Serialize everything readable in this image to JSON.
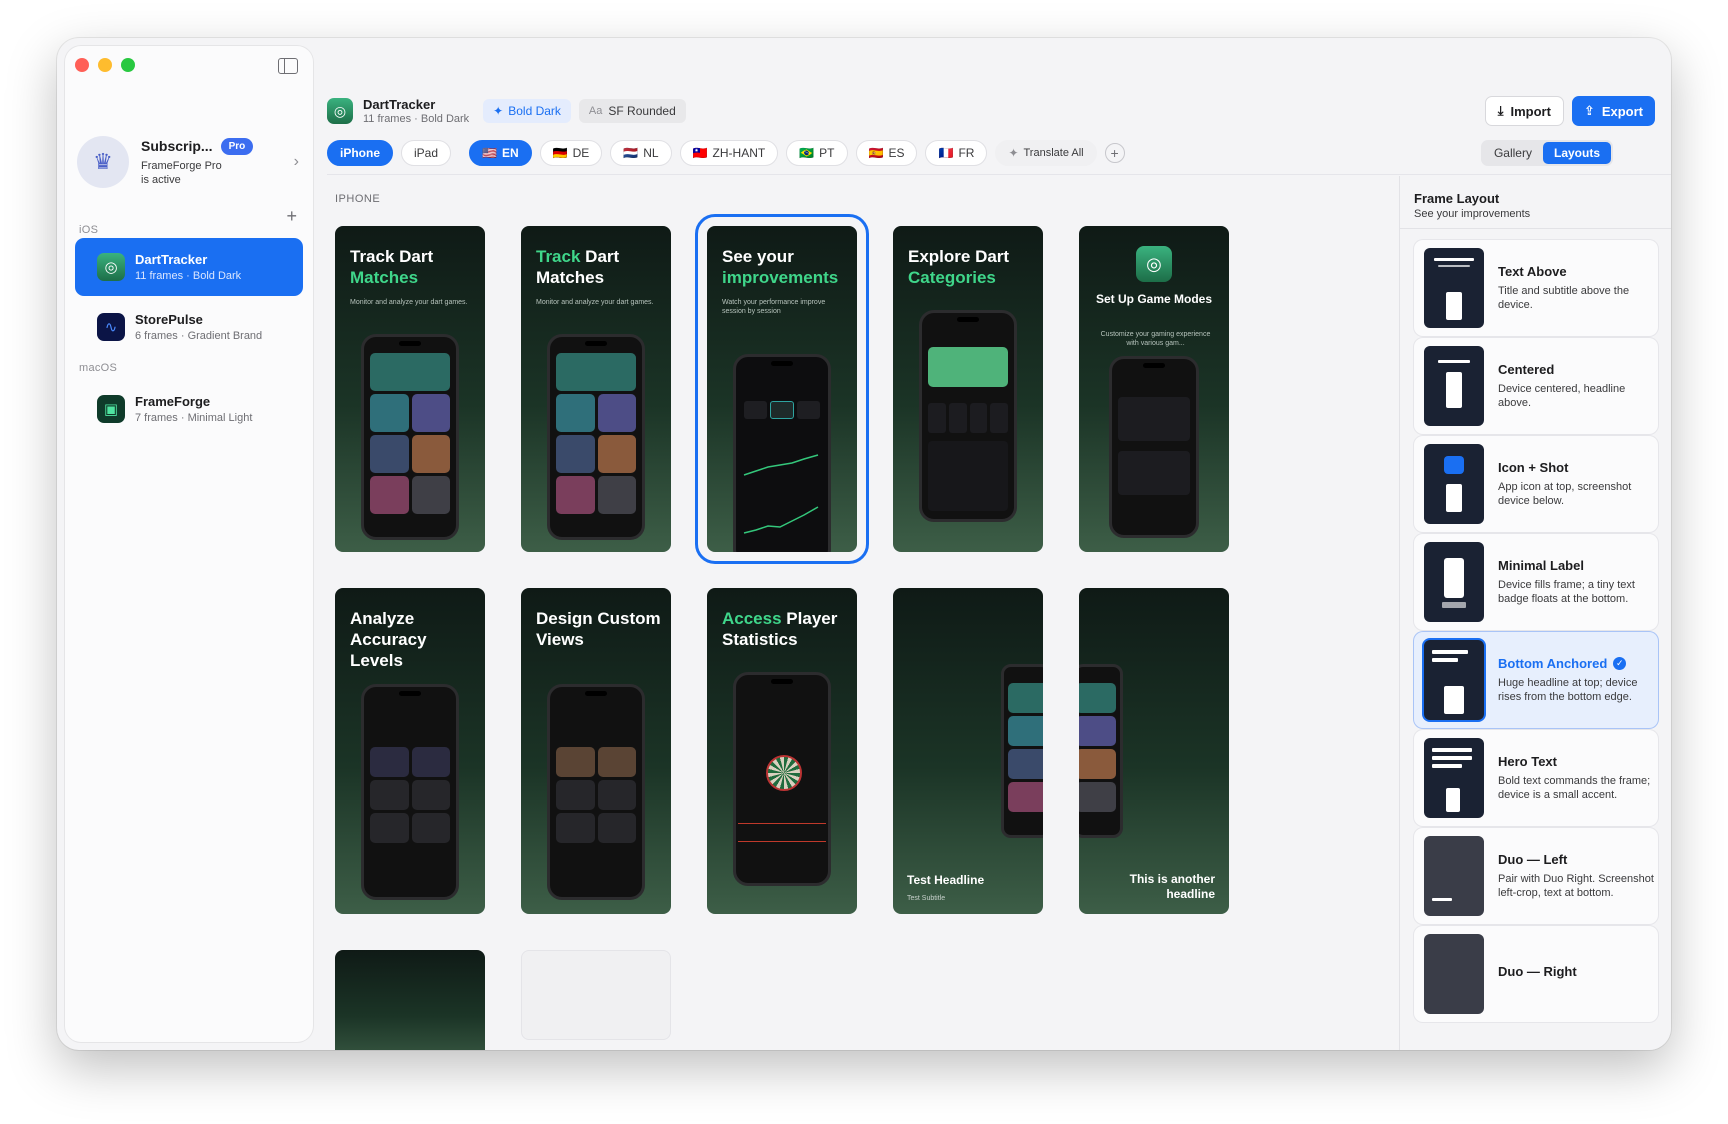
{
  "sidebar": {
    "subscription": {
      "title": "Subscrip...",
      "badge": "Pro",
      "desc_line1": "FrameForge Pro",
      "desc_line2": "is active"
    },
    "sections": [
      "iOS",
      "macOS"
    ],
    "projects": [
      {
        "name": "DartTracker",
        "meta": "11 frames · Bold Dark",
        "active": true
      },
      {
        "name": "StorePulse",
        "meta": "6 frames · Gradient Brand",
        "active": false
      },
      {
        "name": "FrameForge",
        "meta": "7 frames · Minimal Light",
        "active": false
      }
    ]
  },
  "header": {
    "app_name": "DartTracker",
    "app_meta": "11 frames · Bold Dark",
    "theme_chip": "Bold Dark",
    "font_chip": "SF Rounded",
    "font_chip_prefix": "Aa",
    "import_label": "Import",
    "export_label": "Export"
  },
  "toolbar": {
    "devices": [
      "iPhone",
      "iPad"
    ],
    "selected_device": "iPhone",
    "languages": [
      {
        "flag": "🇺🇸",
        "code": "EN",
        "on": true
      },
      {
        "flag": "🇩🇪",
        "code": "DE",
        "on": false
      },
      {
        "flag": "🇳🇱",
        "code": "NL",
        "on": false
      },
      {
        "flag": "🇹🇼",
        "code": "ZH-HANT",
        "on": false
      },
      {
        "flag": "🇧🇷",
        "code": "PT",
        "on": false
      },
      {
        "flag": "🇪🇸",
        "code": "ES",
        "on": false
      },
      {
        "flag": "🇫🇷",
        "code": "FR",
        "on": false
      }
    ],
    "translate_all": "Translate All",
    "views": [
      "Gallery",
      "Layouts"
    ],
    "selected_view": "Layouts"
  },
  "canvas": {
    "section_label": "IPHONE",
    "frames": [
      {
        "head_a": "Track Dart",
        "head_b": "Matches",
        "sub": "Monitor and analyze your dart games."
      },
      {
        "head_a": "Track",
        "head_b": "Dart Matches",
        "sub": "Monitor and analyze your dart games."
      },
      {
        "head_a": "See your",
        "head_b": "improvements",
        "sub": "Watch your performance improve session by session"
      },
      {
        "head_a": "Explore Dart",
        "head_b": "Categories",
        "sub": ""
      },
      {
        "head_a": "Set Up Game Modes",
        "head_b": "",
        "sub": "Customize your gaming experience with various gam..."
      },
      {
        "head_a": "Analyze Accuracy Levels",
        "head_b": "",
        "sub": ""
      },
      {
        "head_a": "Design Custom Views",
        "head_b": "",
        "sub": ""
      },
      {
        "head_a": "Access",
        "head_b": "Player Statistics",
        "sub": ""
      },
      {
        "head_a": "Test Headline",
        "head_b": "",
        "sub": "Test Subtitle"
      },
      {
        "head_a": "This is another headline",
        "head_b": "",
        "sub": ""
      }
    ]
  },
  "panel": {
    "title": "Frame Layout",
    "subtitle": "See your improvements",
    "layouts": [
      {
        "name": "Text Above",
        "desc": "Title and subtitle above the device.",
        "selected": false
      },
      {
        "name": "Centered",
        "desc": "Device centered, headline above.",
        "selected": false
      },
      {
        "name": "Icon + Shot",
        "desc": "App icon at top, screenshot device below.",
        "selected": false
      },
      {
        "name": "Minimal Label",
        "desc": "Device fills frame; a tiny text badge floats at the bottom.",
        "selected": false
      },
      {
        "name": "Bottom Anchored",
        "desc": "Huge headline at top; device rises from the bottom edge.",
        "selected": true
      },
      {
        "name": "Hero Text",
        "desc": "Bold text commands the frame; device is a small accent.",
        "selected": false
      },
      {
        "name": "Duo — Left",
        "desc": "Pair with Duo Right. Screenshot left-crop, text at bottom.",
        "selected": false
      },
      {
        "name": "Duo — Right",
        "desc": "",
        "selected": false
      }
    ]
  },
  "colors": {
    "accent": "#1a6ff2",
    "brand_green": "#3fd68a",
    "frame_dark": "#0f1a16"
  }
}
